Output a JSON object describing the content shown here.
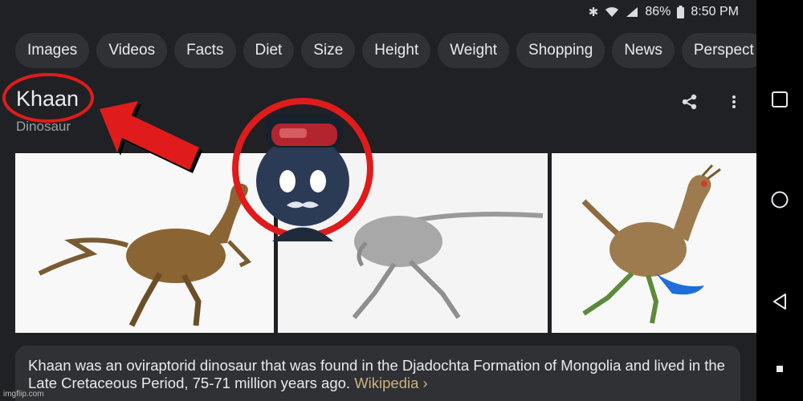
{
  "status_bar": {
    "battery": "86%",
    "time": "8:50 PM",
    "icons": [
      "bluetooth-icon",
      "wifi-icon",
      "signal-icon",
      "battery-icon"
    ]
  },
  "chips": [
    "Images",
    "Videos",
    "Facts",
    "Diet",
    "Size",
    "Height",
    "Weight",
    "Shopping",
    "News",
    "Perspect"
  ],
  "entity": {
    "title": "Khaan",
    "subtitle": "Dinosaur"
  },
  "description": {
    "text": "Khaan was an oviraptorid dinosaur that was found in the Djadochta Formation of Mongolia and lived in the Late Cretaceous Period, 75-71 million years ago.",
    "source_link": "Wikipedia ›"
  },
  "watermark": "imgflip.com",
  "colors": {
    "background": "#202124",
    "chip": "#303134",
    "link": "#c9b37e",
    "annotation_red": "#e01b1b"
  },
  "nav_bar": {
    "buttons": [
      "recent-apps-icon",
      "home-icon",
      "back-icon",
      "menu-dot-icon"
    ]
  }
}
